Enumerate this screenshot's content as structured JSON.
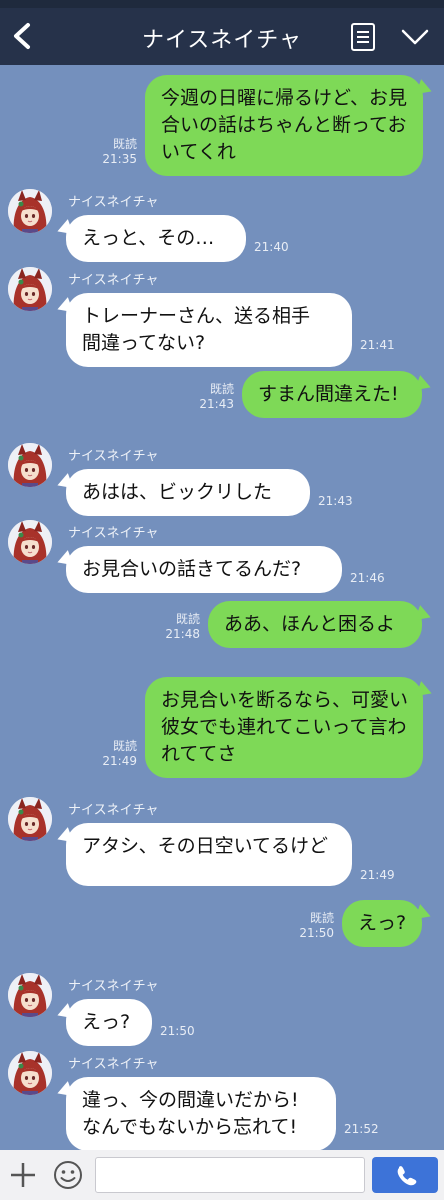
{
  "header": {
    "title": "ナイスネイチャ"
  },
  "messages": [
    {
      "side": "out",
      "text": "今週の日曜に帰るけど、お見合いの話はちゃんと断っておいてくれ",
      "read": "既読",
      "time": "21:35"
    },
    {
      "side": "in",
      "name": "ナイスネイチャ",
      "text": "えっと、その…",
      "time": "21:40"
    },
    {
      "side": "in",
      "name": "ナイスネイチャ",
      "text": "トレーナーさん、送る相手\n間違ってない?",
      "time": "21:41"
    },
    {
      "side": "out",
      "text": "すまん間違えた!",
      "read": "既読",
      "time": "21:43"
    },
    {
      "side": "in",
      "name": "ナイスネイチャ",
      "text": "あはは、ビックリした",
      "time": "21:43"
    },
    {
      "side": "in",
      "name": "ナイスネイチャ",
      "text": "お見合いの話きてるんだ?",
      "time": "21:46"
    },
    {
      "side": "out",
      "text": "ああ、ほんと困るよ",
      "read": "既読",
      "time": "21:48"
    },
    {
      "side": "out",
      "text": "お見合いを断るなら、可愛い彼女でも連れてこいって言われててさ",
      "read": "既読",
      "time": "21:49"
    },
    {
      "side": "in",
      "name": "ナイスネイチャ",
      "text": "アタシ、その日空いてるけど",
      "time": "21:49"
    },
    {
      "side": "out",
      "text": "えっ?",
      "read": "既読",
      "time": "21:50"
    },
    {
      "side": "in",
      "name": "ナイスネイチャ",
      "text": "えっ?",
      "time": "21:50"
    },
    {
      "side": "in",
      "name": "ナイスネイチャ",
      "text": "違っ、今の間違いだから!\nなんでもないから忘れて!",
      "time": "21:52"
    }
  ],
  "input": {
    "placeholder": ""
  }
}
